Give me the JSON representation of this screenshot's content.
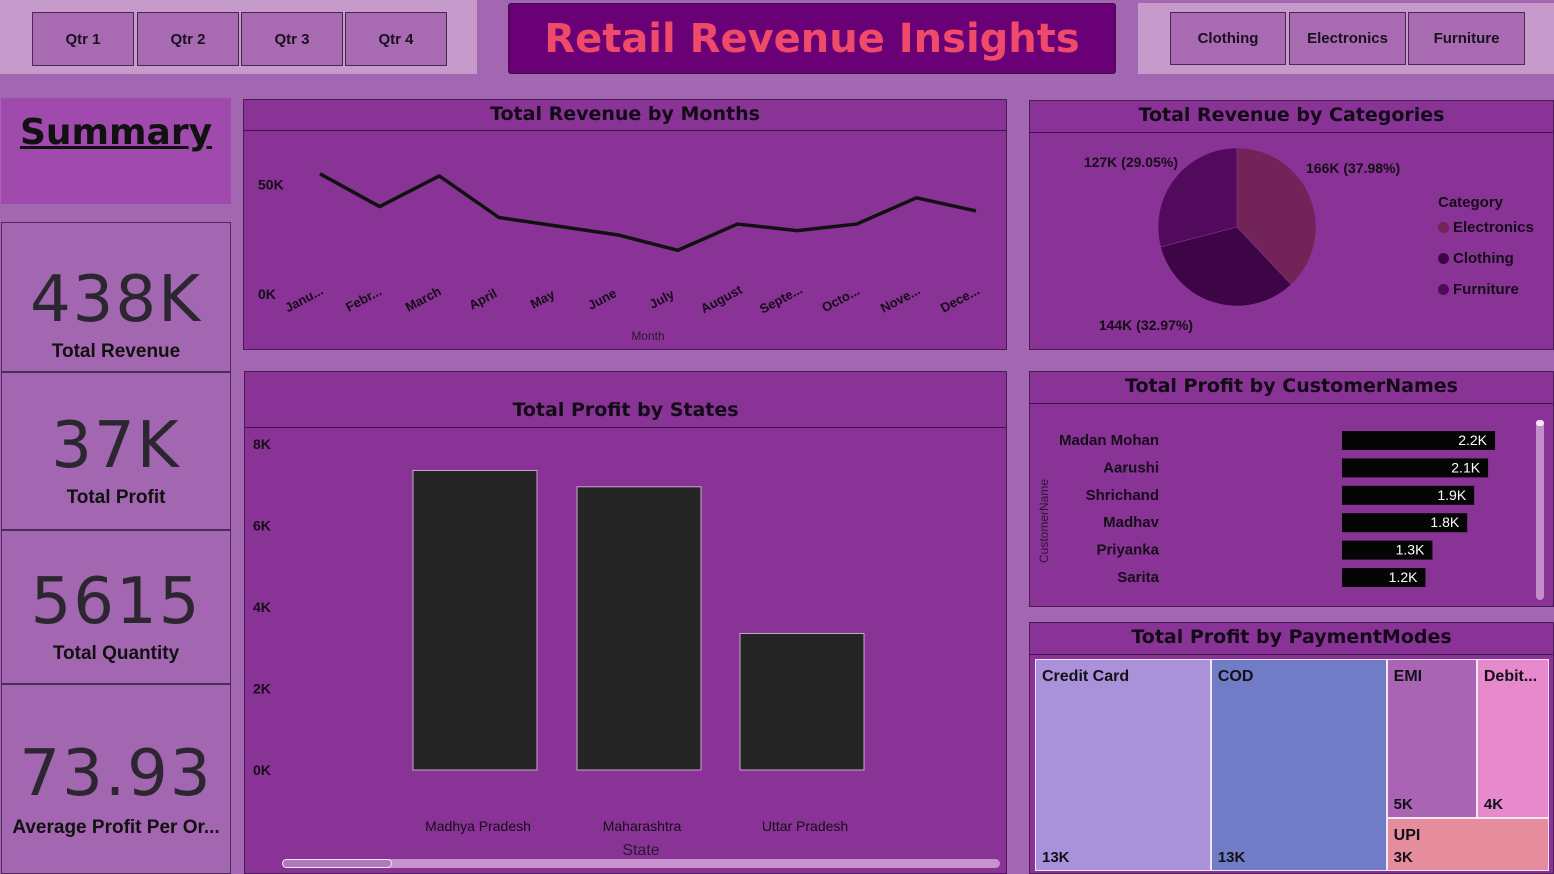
{
  "quarter_slicer": {
    "items": [
      "Qtr 1",
      "Qtr 2",
      "Qtr 3",
      "Qtr 4"
    ]
  },
  "category_slicer": {
    "items": [
      "Clothing",
      "Electronics",
      "Furniture"
    ]
  },
  "header": {
    "title": "Retail Revenue Insights"
  },
  "summary": {
    "heading": "Summary",
    "kpis": [
      {
        "value": "438K",
        "label": "Total Revenue"
      },
      {
        "value": "37K",
        "label": "Total Profit"
      },
      {
        "value": "5615",
        "label": "Total Quantity"
      },
      {
        "value": "73.93",
        "label": "Average Profit Per Or..."
      }
    ]
  },
  "colors": {
    "background": "#a366b0",
    "panel": "#8a3396",
    "title_bar": "#6a0075",
    "title_text": "#f04a6a",
    "bar": "#252525",
    "line": "#111111"
  },
  "chart_data": [
    {
      "type": "line",
      "title": "Total Revenue by Months",
      "xlabel": "Month",
      "ylabel": "",
      "x": [
        "Janu...",
        "Febr...",
        "March",
        "April",
        "May",
        "June",
        "July",
        "August",
        "Septe...",
        "Octo...",
        "Nove...",
        "Dece..."
      ],
      "values": [
        55000,
        40000,
        54000,
        35000,
        31000,
        27000,
        20000,
        32000,
        29000,
        32000,
        44000,
        38000
      ],
      "y_ticks": [
        "0K",
        "50K"
      ],
      "ylim": [
        0,
        70000
      ],
      "grid": false
    },
    {
      "type": "pie",
      "title": "Total Revenue by Categories",
      "legend_title": "Category",
      "legend_position": "right",
      "slices": [
        {
          "name": "Electronics",
          "value": 166000,
          "label": "166K (37.98%)",
          "color": "#722357"
        },
        {
          "name": "Clothing",
          "value": 144000,
          "label": "144K (32.97%)",
          "color": "#3e0546"
        },
        {
          "name": "Furniture",
          "value": 127000,
          "label": "127K (29.05%)",
          "color": "#520a5c"
        }
      ]
    },
    {
      "type": "bar",
      "title": "Total Profit by States",
      "xlabel": "State",
      "ylabel": "",
      "categories": [
        "Madhya Pradesh",
        "Maharashtra",
        "Uttar Pradesh"
      ],
      "values": [
        7350,
        6950,
        3350
      ],
      "y_ticks": [
        "0K",
        "2K",
        "4K",
        "6K",
        "8K"
      ],
      "ylim": [
        0,
        8000
      ],
      "grid": false
    },
    {
      "type": "bar",
      "orientation": "horizontal",
      "title": "Total Profit by CustomerNames",
      "ylabel": "CustomerName",
      "categories": [
        "Madan Mohan",
        "Aarushi",
        "Shrichand",
        "Madhav",
        "Priyanka",
        "Sarita"
      ],
      "values": [
        2200,
        2100,
        1900,
        1800,
        1300,
        1200
      ],
      "data_labels": [
        "2.2K",
        "2.1K",
        "1.9K",
        "1.8K",
        "1.3K",
        "1.2K"
      ],
      "xlim": [
        0,
        2300
      ]
    },
    {
      "type": "treemap",
      "title": "Total Profit by PaymentModes",
      "items": [
        {
          "name": "Credit Card",
          "value": 13000,
          "label": "13K",
          "color": "#a992da"
        },
        {
          "name": "COD",
          "value": 13000,
          "label": "13K",
          "color": "#707cc6"
        },
        {
          "name": "EMI",
          "value": 5000,
          "label": "5K",
          "color": "#a964b4"
        },
        {
          "name": "Debit...",
          "value": 4000,
          "label": "4K",
          "color": "#e789cd"
        },
        {
          "name": "UPI",
          "value": 3000,
          "label": "3K",
          "color": "#e58c9d"
        }
      ]
    }
  ]
}
